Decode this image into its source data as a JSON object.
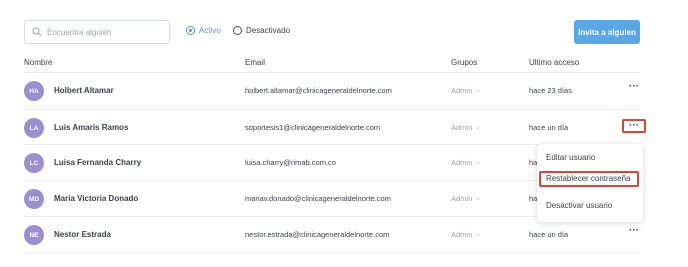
{
  "search": {
    "placeholder": "Encuentra alguien",
    "value": ""
  },
  "filters": {
    "active_label": "Activo",
    "inactive_label": "Desactivado",
    "selected": "Activo"
  },
  "invite_button": "Invita a alguien",
  "table": {
    "headers": {
      "name": "Nombre",
      "email": "Email",
      "groups": "Grupos",
      "last_access": "Ultimo acceso"
    },
    "rows": [
      {
        "initials": "HA",
        "name": "Holbert Altamar",
        "email": "holbert.altamar@clinicageneraldelnorte.com",
        "group": "Admin",
        "last_access": "hace 23 días"
      },
      {
        "initials": "LA",
        "name": "Luis Amaris Ramos",
        "email": "soportesis1@clinicageneraldelnorte.com",
        "group": "Admin",
        "last_access": "hace un día"
      },
      {
        "initials": "LC",
        "name": "Luisa Fernanda Charry",
        "email": "luisa.charry@rimab.com.co",
        "group": "Admin",
        "last_access": "ha"
      },
      {
        "initials": "MD",
        "name": "Maria Victoria Donado",
        "email": "mariav.donado@clinicageneraldelnorte.com",
        "group": "Admin",
        "last_access": "ha"
      },
      {
        "initials": "NE",
        "name": "Nestor Estrada",
        "email": "nestor.estrada@clinicageneraldelnorte.com",
        "group": "Admin",
        "last_access": "hace un día"
      }
    ]
  },
  "row_menu": {
    "items": [
      "Editar usuario",
      "Restablecer contraseña",
      "Desactivar usuario"
    ]
  },
  "colors": {
    "accent": "#4a90e2",
    "button": "#5aa7e8",
    "avatar": "#9b8fd0",
    "highlight": "#d9453b"
  }
}
